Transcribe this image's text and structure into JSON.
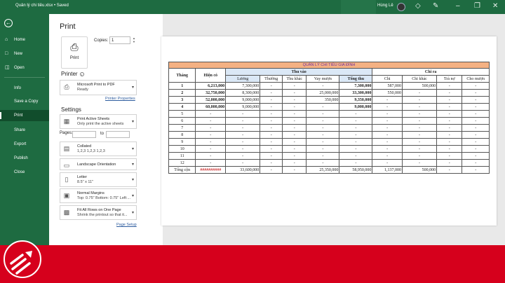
{
  "titlebar": {
    "title": "Quản lý chi tiêu.xlsx • Saved",
    "user": "Hùng Lê",
    "icons": [
      "diamond-icon",
      "pen-icon",
      "minimize-icon",
      "restore-icon",
      "close-icon"
    ]
  },
  "sidebar": {
    "back_icon": "back-arrow-icon",
    "items": [
      {
        "label": "Home",
        "icon": "home-icon"
      },
      {
        "label": "New",
        "icon": "new-file-icon"
      },
      {
        "label": "Open",
        "icon": "folder-icon"
      },
      {
        "label": "Info"
      },
      {
        "label": "Save a Copy"
      },
      {
        "label": "Print",
        "active": true
      },
      {
        "label": "Share"
      },
      {
        "label": "Export"
      },
      {
        "label": "Publish"
      },
      {
        "label": "Close"
      }
    ]
  },
  "print_panel": {
    "title": "Print",
    "print_button": "Print",
    "copies_label": "Copies:",
    "copies_value": "1",
    "printer_heading": "Printer",
    "printer_name": "Microsoft Print to PDF",
    "printer_status": "Ready",
    "printer_properties": "Printer Properties",
    "settings_heading": "Settings",
    "settings": [
      {
        "line1": "Print Active Sheets",
        "line2": "Only print the active sheets"
      },
      {
        "line1": "Collated",
        "line2": "1,2,3    1,2,3    1,2,3"
      },
      {
        "line1": "Landscape Orientation",
        "line2": ""
      },
      {
        "line1": "Letter",
        "line2": "8.5\" x 11\""
      },
      {
        "line1": "Normal Margins",
        "line2": "Top: 0.75\" Bottom: 0.75\" Left:..."
      },
      {
        "line1": "Fit All Rows on One Page",
        "line2": "Shrink the printout so that it..."
      }
    ],
    "pages_label": "Pages:",
    "pages_to": "to",
    "page_setup": "Page Setup"
  },
  "sheet": {
    "title": "QUẢN LÝ CHI TIÊU GIA ĐÌNH",
    "h_thang": "Tháng",
    "h_hienco": "Hiện có",
    "h_thuvao": "Thu vào",
    "h_chira": "Chi ra",
    "sub_headers": [
      "Lương",
      "Thưởng",
      "Thu khác",
      "Vay mượn",
      "Tổng thu",
      "Chi",
      "Chi khác",
      "Trả nợ",
      "Cho mượn"
    ],
    "rows": [
      [
        "1",
        "6,213,000",
        "7,300,000",
        "-",
        "-",
        "-",
        "7,300,000",
        "587,000",
        "500,000",
        "-",
        "-"
      ],
      [
        "2",
        "32,750,000",
        "8,300,000",
        "-",
        "-",
        "25,000,000",
        "33,300,000",
        "550,000",
        "-",
        "-",
        "-"
      ],
      [
        "3",
        "52,000,000",
        "9,000,000",
        "-",
        "-",
        "350,000",
        "9,350,000",
        "-",
        "-",
        "-",
        "-"
      ],
      [
        "4",
        "60,000,000",
        "9,000,000",
        "-",
        "-",
        "-",
        "9,000,000",
        "-",
        "-",
        "-",
        "-"
      ],
      [
        "5",
        "-",
        "-",
        "-",
        "-",
        "-",
        "-",
        "-",
        "-",
        "-",
        "-"
      ],
      [
        "6",
        "-",
        "-",
        "-",
        "-",
        "-",
        "-",
        "-",
        "-",
        "-",
        "-"
      ],
      [
        "7",
        "-",
        "-",
        "-",
        "-",
        "-",
        "-",
        "-",
        "-",
        "-",
        "-"
      ],
      [
        "8",
        "-",
        "-",
        "-",
        "-",
        "-",
        "-",
        "-",
        "-",
        "-",
        "-"
      ],
      [
        "9",
        "-",
        "-",
        "-",
        "-",
        "-",
        "-",
        "-",
        "-",
        "-",
        "-"
      ],
      [
        "10",
        "-",
        "-",
        "-",
        "-",
        "-",
        "-",
        "-",
        "-",
        "-",
        "-"
      ],
      [
        "11",
        "-",
        "-",
        "-",
        "-",
        "-",
        "-",
        "-",
        "-",
        "-",
        "-"
      ],
      [
        "12",
        "-",
        "-",
        "-",
        "-",
        "-",
        "-",
        "-",
        "-",
        "-",
        "-"
      ]
    ],
    "total": [
      "Tổng cộn",
      "##########",
      "33,600,000",
      "-",
      "-",
      "25,350,000",
      "58,950,000",
      "1,137,000",
      "500,000",
      "-",
      "-"
    ]
  },
  "colors": {
    "excel_green": "#1e6b41",
    "band_red": "#d6001c",
    "title_fill": "#f4b183",
    "header_fill": "#dbe8f6"
  }
}
